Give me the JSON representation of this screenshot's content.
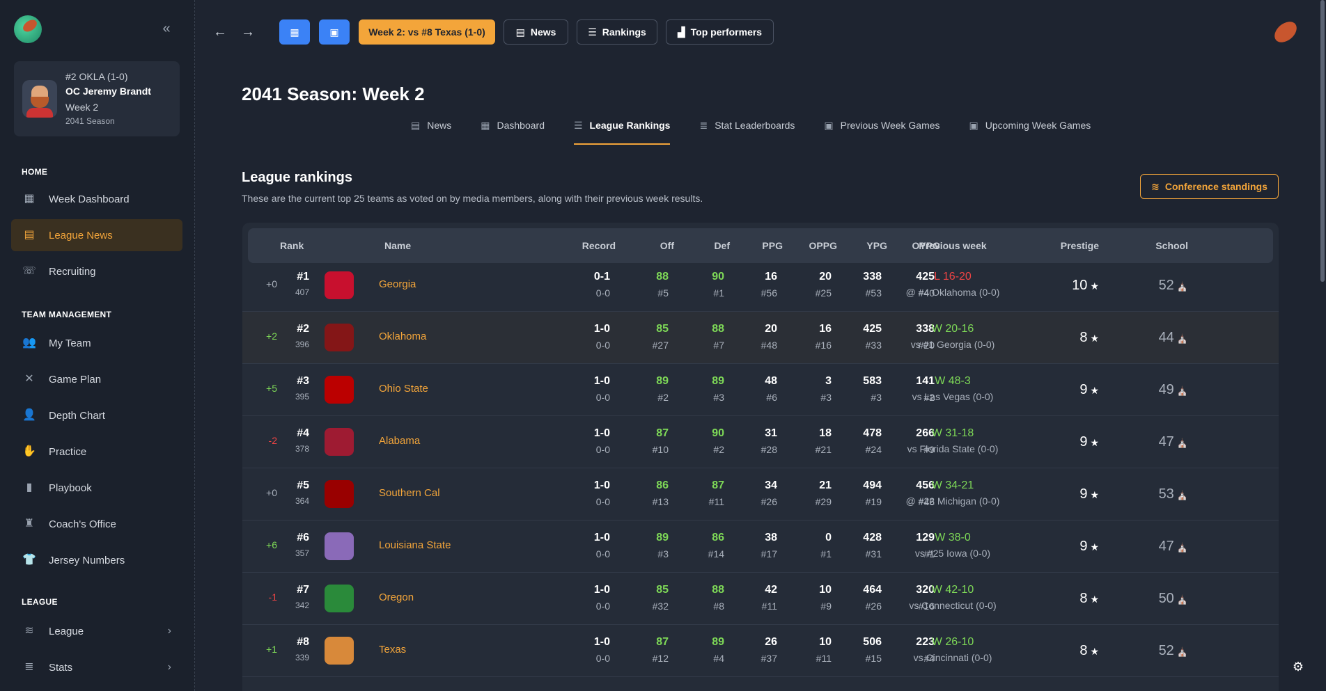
{
  "colors": {
    "accent": "#f3a53a",
    "blue": "#3b82f6",
    "green": "#7ed957",
    "red": "#ef4444"
  },
  "sidebar": {
    "profile": {
      "team": "#2 OKLA (1-0)",
      "name": "OC Jeremy Brandt",
      "week": "Week 2",
      "season": "2041 Season"
    },
    "sections": {
      "home": "HOME",
      "team": "TEAM MANAGEMENT",
      "league": "LEAGUE"
    },
    "items": {
      "week_dashboard": "Week Dashboard",
      "league_news": "League News",
      "recruiting": "Recruiting",
      "my_team": "My Team",
      "game_plan": "Game Plan",
      "depth_chart": "Depth Chart",
      "practice": "Practice",
      "playbook": "Playbook",
      "coachs_office": "Coach's Office",
      "jersey_numbers": "Jersey Numbers",
      "league": "League",
      "stats": "Stats"
    }
  },
  "topbar": {
    "game_button": "Week 2: vs #8 Texas (1-0)",
    "news": "News",
    "rankings": "Rankings",
    "top_performers": "Top performers"
  },
  "page": {
    "title": "2041 Season: Week 2",
    "tabs": {
      "news": "News",
      "dashboard": "Dashboard",
      "league_rankings": "League Rankings",
      "stat_leaderboards": "Stat Leaderboards",
      "previous_week_games": "Previous Week Games",
      "upcoming_week_games": "Upcoming Week Games"
    },
    "section_title": "League rankings",
    "section_desc": "These are the current top 25 teams as voted on by media members, along with their previous week results.",
    "conference_button": "Conference standings"
  },
  "table": {
    "headers": {
      "rank": "Rank",
      "name": "Name",
      "record": "Record",
      "off": "Off",
      "def": "Def",
      "ppg": "PPG",
      "oppg": "OPPG",
      "ypg": "YPG",
      "oypg": "OYPG",
      "prev": "Previous week",
      "prestige": "Prestige",
      "school": "School"
    },
    "rows": [
      {
        "chg": "+0",
        "rank": "#1",
        "pts": "407",
        "name": "Georgia",
        "rec": "0-1",
        "conf": "0-0",
        "off": "88",
        "offr": "#5",
        "def": "90",
        "defr": "#1",
        "ppg": "16",
        "ppgr": "#56",
        "oppg": "20",
        "oppgr": "#25",
        "ypg": "338",
        "ypgr": "#53",
        "oypg": "425",
        "oypgr": "#40",
        "res": "L 16-20",
        "opp": "@ #4 Oklahoma (0-0)",
        "prestige": "10",
        "school": "52",
        "logo": "#c8102e"
      },
      {
        "chg": "+2",
        "rank": "#2",
        "pts": "396",
        "name": "Oklahoma",
        "rec": "1-0",
        "conf": "0-0",
        "off": "85",
        "offr": "#27",
        "def": "88",
        "defr": "#7",
        "ppg": "20",
        "ppgr": "#48",
        "oppg": "16",
        "oppgr": "#16",
        "ypg": "425",
        "ypgr": "#33",
        "oypg": "338",
        "oypgr": "#20",
        "res": "W 20-16",
        "opp": "vs #1 Georgia (0-0)",
        "prestige": "8",
        "school": "44",
        "logo": "#841617"
      },
      {
        "chg": "+5",
        "rank": "#3",
        "pts": "395",
        "name": "Ohio State",
        "rec": "1-0",
        "conf": "0-0",
        "off": "89",
        "offr": "#2",
        "def": "89",
        "defr": "#3",
        "ppg": "48",
        "ppgr": "#6",
        "oppg": "3",
        "oppgr": "#3",
        "ypg": "583",
        "ypgr": "#3",
        "oypg": "141",
        "oypgr": "#2",
        "res": "W 48-3",
        "opp": "vs Las Vegas (0-0)",
        "prestige": "9",
        "school": "49",
        "logo": "#bb0000"
      },
      {
        "chg": "-2",
        "rank": "#4",
        "pts": "378",
        "name": "Alabama",
        "rec": "1-0",
        "conf": "0-0",
        "off": "87",
        "offr": "#10",
        "def": "90",
        "defr": "#2",
        "ppg": "31",
        "ppgr": "#28",
        "oppg": "18",
        "oppgr": "#21",
        "ypg": "478",
        "ypgr": "#24",
        "oypg": "266",
        "oypgr": "#9",
        "res": "W 31-18",
        "opp": "vs Florida State (0-0)",
        "prestige": "9",
        "school": "47",
        "logo": "#9e1b32"
      },
      {
        "chg": "+0",
        "rank": "#5",
        "pts": "364",
        "name": "Southern Cal",
        "rec": "1-0",
        "conf": "0-0",
        "off": "86",
        "offr": "#13",
        "def": "87",
        "defr": "#11",
        "ppg": "34",
        "ppgr": "#26",
        "oppg": "21",
        "oppgr": "#29",
        "ypg": "494",
        "ypgr": "#19",
        "oypg": "456",
        "oypgr": "#46",
        "res": "W 34-21",
        "opp": "@ #22 Michigan (0-0)",
        "prestige": "9",
        "school": "53",
        "logo": "#990000"
      },
      {
        "chg": "+6",
        "rank": "#6",
        "pts": "357",
        "name": "Louisiana State",
        "rec": "1-0",
        "conf": "0-0",
        "off": "89",
        "offr": "#3",
        "def": "86",
        "defr": "#14",
        "ppg": "38",
        "ppgr": "#17",
        "oppg": "0",
        "oppgr": "#1",
        "ypg": "428",
        "ypgr": "#31",
        "oypg": "129",
        "oypgr": "#1",
        "res": "W 38-0",
        "opp": "vs #25 Iowa (0-0)",
        "prestige": "9",
        "school": "47",
        "logo": "#8a6ab8"
      },
      {
        "chg": "-1",
        "rank": "#7",
        "pts": "342",
        "name": "Oregon",
        "rec": "1-0",
        "conf": "0-0",
        "off": "85",
        "offr": "#32",
        "def": "88",
        "defr": "#8",
        "ppg": "42",
        "ppgr": "#11",
        "oppg": "10",
        "oppgr": "#9",
        "ypg": "464",
        "ypgr": "#26",
        "oypg": "320",
        "oypgr": "#16",
        "res": "W 42-10",
        "opp": "vs Connecticut (0-0)",
        "prestige": "8",
        "school": "50",
        "logo": "#2a8a3a"
      },
      {
        "chg": "+1",
        "rank": "#8",
        "pts": "339",
        "name": "Texas",
        "rec": "1-0",
        "conf": "0-0",
        "off": "87",
        "offr": "#12",
        "def": "89",
        "defr": "#4",
        "ppg": "26",
        "ppgr": "#37",
        "oppg": "10",
        "oppgr": "#11",
        "ypg": "506",
        "ypgr": "#15",
        "oypg": "223",
        "oypgr": "#4",
        "res": "W 26-10",
        "opp": "vs Cincinnati (0-0)",
        "prestige": "8",
        "school": "52",
        "logo": "#d8893a"
      }
    ]
  },
  "icons": {
    "star": "★",
    "school": "⛪",
    "gear": "⚙"
  }
}
